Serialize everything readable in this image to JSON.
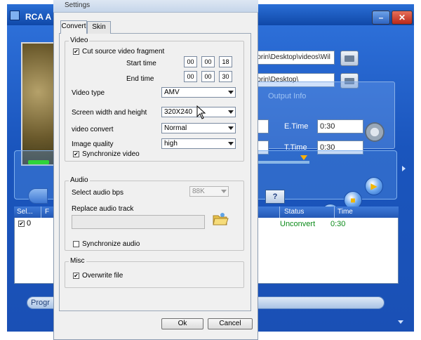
{
  "app": {
    "title": "RCA A",
    "output_path": "Florin\\Desktop\\videos\\Wil",
    "output_folder": "Florin\\Desktop\\",
    "output_info_label": "Output Info",
    "etime_label": "E.Time",
    "etime_value": "0:30",
    "ttime_label": "T.Time",
    "ttime_value": "0:30",
    "help_label": "?",
    "progress_label": "Progr",
    "list": {
      "headers": [
        "Sel...",
        "F",
        "Status",
        "Time"
      ],
      "rows": [
        {
          "selected": true,
          "num": "0",
          "status": "Unconvert",
          "time": "0:30"
        }
      ]
    },
    "colors": {
      "status_green": "#0a8a18",
      "accent_blue": "#1f5ec4"
    }
  },
  "dialog": {
    "title": "Settings",
    "tabs": [
      "Convert",
      "Skin"
    ],
    "video": {
      "group_label": "Video",
      "cut_fragment_label": "Cut source video fragment",
      "cut_fragment_checked": true,
      "start_time_label": "Start time",
      "start_time": [
        "00",
        "00",
        "18"
      ],
      "end_time_label": "End time",
      "end_time": [
        "00",
        "00",
        "30"
      ],
      "video_type_label": "Video type",
      "video_type": "AMV",
      "screen_size_label": "Screen width and height",
      "screen_size": "320X240",
      "video_convert_label": "video convert",
      "video_convert": "Normal",
      "image_quality_label": "Image quality",
      "image_quality": "high",
      "sync_video_label": "Synchronize video",
      "sync_video_checked": true
    },
    "audio": {
      "group_label": "Audio",
      "bps_label": "Select audio bps",
      "bps_value": "88K",
      "replace_track_label": "Replace audio track",
      "sync_audio_label": "Synchronize audio",
      "sync_audio_checked": false
    },
    "misc": {
      "group_label": "Misc",
      "overwrite_label": "Overwrite file",
      "overwrite_checked": true
    },
    "ok_label": "Ok",
    "cancel_label": "Cancel",
    "check_glyph": "✔"
  }
}
